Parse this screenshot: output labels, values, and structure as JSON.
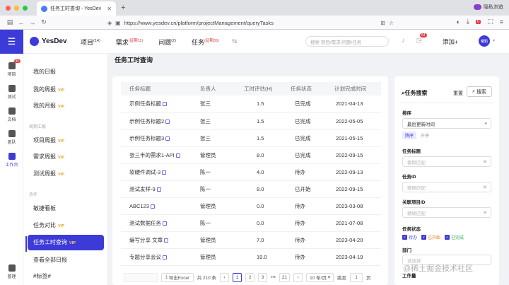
{
  "browser": {
    "tab_title": "任务工时查询 - YesDev",
    "private_label": "隐私浏览",
    "url": "https://www.yesdev.cn/platform/projectManagement/queryTasks",
    "ext_badge": "0"
  },
  "header": {
    "logo": "YesDev",
    "nav": [
      {
        "label": "项目",
        "count": "(14)"
      },
      {
        "label": "需求",
        "count": "(延期11)"
      },
      {
        "label": "问题",
        "count": "(2)"
      },
      {
        "label": "任务",
        "count": "(延期35)"
      }
    ],
    "search_placeholder": "搜索 项目/需求/问题/任务",
    "notify_count": "64",
    "add_label": "添加+",
    "avatar_text": "曙鸦"
  },
  "rail": [
    {
      "label": "项目",
      "badge": "31"
    },
    {
      "label": "测试"
    },
    {
      "label": "文档"
    },
    {
      "label": "团队"
    },
    {
      "label": "工作台"
    },
    {
      "label": "管理"
    }
  ],
  "subnav": {
    "vip": "VIP",
    "group_report": "周期汇报",
    "group_tools": "协作",
    "items": [
      "我的日报",
      "我的周报",
      "我的月报",
      "项目周报",
      "需求周报",
      "测试周报",
      "敏捷看板",
      "任务对比",
      "任务工时查询",
      "查看全部日报",
      "#标签#"
    ]
  },
  "page": {
    "title": "任务工时查询"
  },
  "table": {
    "headers": [
      "任务标题",
      "负责人",
      "工时评估(H)",
      "任务状态",
      "计划完成时间"
    ],
    "rows": [
      {
        "title": "示例任务标题",
        "owner": "张三",
        "hours": "1.5",
        "status": "已完成",
        "date": "2021-04-13",
        "st": "done"
      },
      {
        "title": "示例任务标题2",
        "owner": "张三",
        "hours": "1.5",
        "status": "已完成",
        "date": "2022-05-05",
        "st": "done"
      },
      {
        "title": "示例任务标题3",
        "owner": "张三",
        "hours": "1.5",
        "status": "已完成",
        "date": "2021-05-15",
        "st": "done"
      },
      {
        "title": "张三半的需求1-API",
        "owner": "管理员",
        "hours": "8.0",
        "status": "已完成",
        "date": "2022-09-15",
        "st": "done"
      },
      {
        "title": "软硬件调试-3",
        "owner": "陈一",
        "hours": "4.0",
        "status": "待办",
        "date": "2022-09-13",
        "st": "todo"
      },
      {
        "title": "测试发样-9",
        "owner": "陈一",
        "hours": "8.0",
        "status": "已开始",
        "date": "2022-09-15",
        "st": "start"
      },
      {
        "title": "ABC123",
        "owner": "管理员",
        "hours": "0.0",
        "status": "待办",
        "date": "2023-03-08",
        "st": "todo"
      },
      {
        "title": "测试数据任务",
        "owner": "陈一",
        "hours": "0.0",
        "status": "待办",
        "date": "2021-07-08",
        "st": "todo"
      },
      {
        "title": "编写分享 文章",
        "owner": "管理员",
        "hours": "7.0",
        "status": "待办",
        "date": "2023-04-20",
        "st": "todo"
      },
      {
        "title": "专题分享会议",
        "owner": "管理员",
        "hours": "19.0",
        "status": "待办",
        "date": "2023-04-19",
        "st": "todo"
      }
    ]
  },
  "pager": {
    "export": "导出Excel",
    "total": "共 210 条",
    "pages": [
      "1",
      "2",
      "3"
    ],
    "last": "21",
    "size": "10 条/页",
    "goto": "跳至",
    "goto_val": "1",
    "page_unit": "页"
  },
  "filter": {
    "title": "任务搜索",
    "reset": "重置",
    "search": "搜索",
    "sort_label": "排序",
    "sort_value": "最后更新时间",
    "asc": "降序",
    "desc": "升序",
    "title_label": "任务标题",
    "title_ph": "模糊匹配",
    "id_label": "任务ID",
    "id_ph": "精确匹配",
    "proj_label": "关联项目ID",
    "proj_ph": "精确匹配",
    "status_label": "任务状态",
    "statuses": [
      "待办",
      "已开始",
      "已完成"
    ],
    "dept_label": "部门",
    "dept_ph": "请选择",
    "hours_label": "工作量"
  },
  "watermark": "@稀土掘金技术社区"
}
